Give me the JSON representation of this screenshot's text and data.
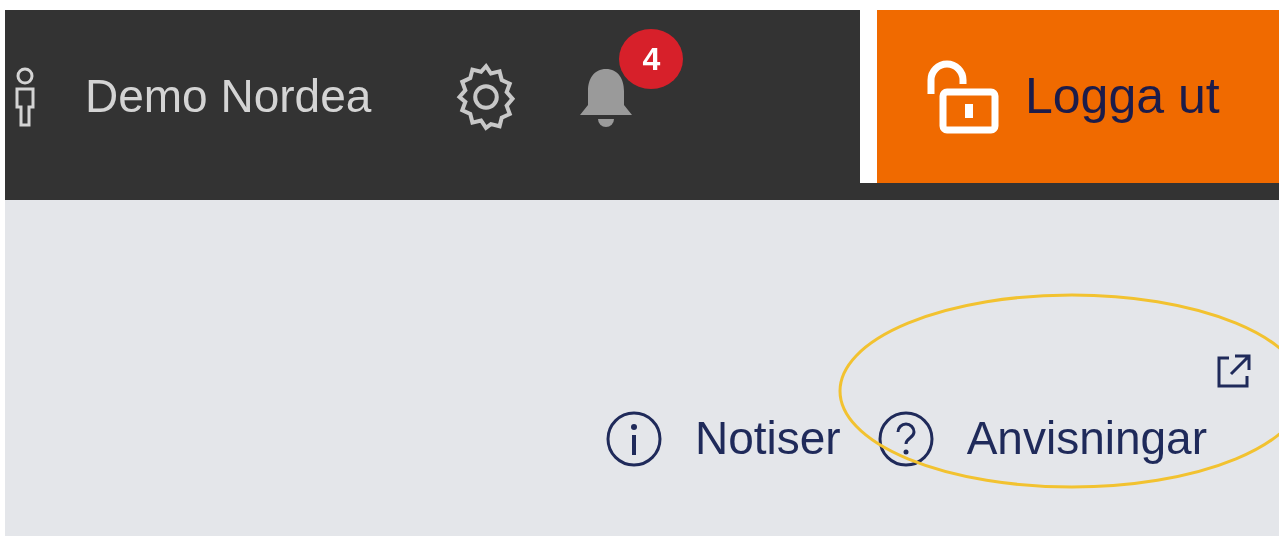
{
  "header": {
    "user_name": "Demo Nordea",
    "notification_count": "4",
    "logout_label": "Logga ut"
  },
  "links": [
    {
      "label": "Notiser",
      "kind": "info",
      "external": false,
      "highlighted": false
    },
    {
      "label": "Anvisningar",
      "kind": "help",
      "external": true,
      "highlighted": true
    }
  ]
}
